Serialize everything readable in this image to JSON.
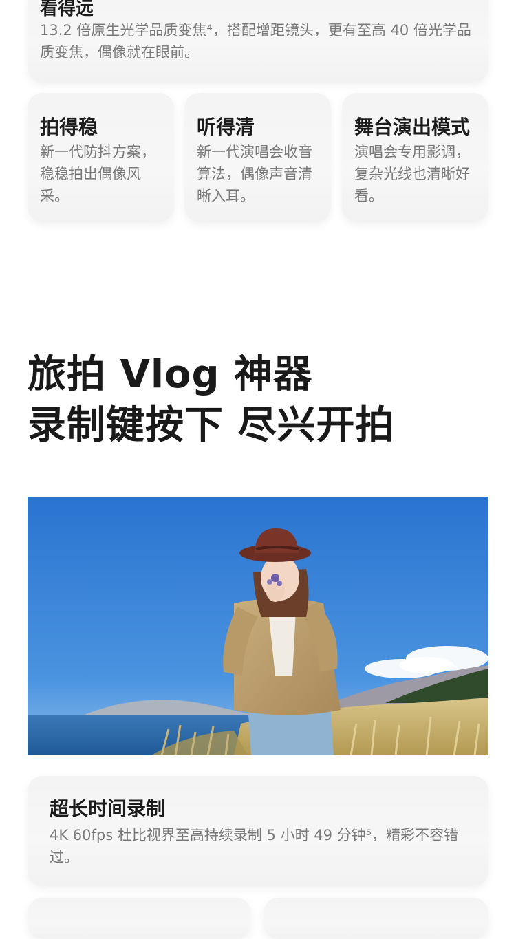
{
  "top_feature": {
    "title": "看得远",
    "desc": "13.2 倍原生光学品质变焦⁴，搭配增距镜头，更有至高 40 倍光学品质变焦，偶像就在眼前。"
  },
  "features": [
    {
      "title": "拍得稳",
      "desc": "新一代防抖方案，稳稳拍出偶像风采。"
    },
    {
      "title": "听得清",
      "desc": "新一代演唱会收音算法，偶像声音清晰入耳。"
    },
    {
      "title": "舞台演出模式",
      "desc": "演唱会专用影调，复杂光线也清晰好看。"
    }
  ],
  "section": {
    "title_line1": "旅拍 Vlog 神器",
    "title_line2": "录制键按下 尽兴开拍"
  },
  "photo": {
    "subject": "woman-in-cowboy-hat-on-lakeside-meadow"
  },
  "bottom_feature": {
    "title": "超长时间录制",
    "desc": "4K 60fps 杜比视界至高持续录制 5 小时 49 分钟⁵，精彩不容错过。"
  },
  "colors": {
    "card_bg": "#f5f5f5",
    "title_text": "#1c1c1c",
    "desc_text": "#7a7a7a",
    "sky": "#2f7fd8",
    "lake": "#2d6aa8"
  }
}
